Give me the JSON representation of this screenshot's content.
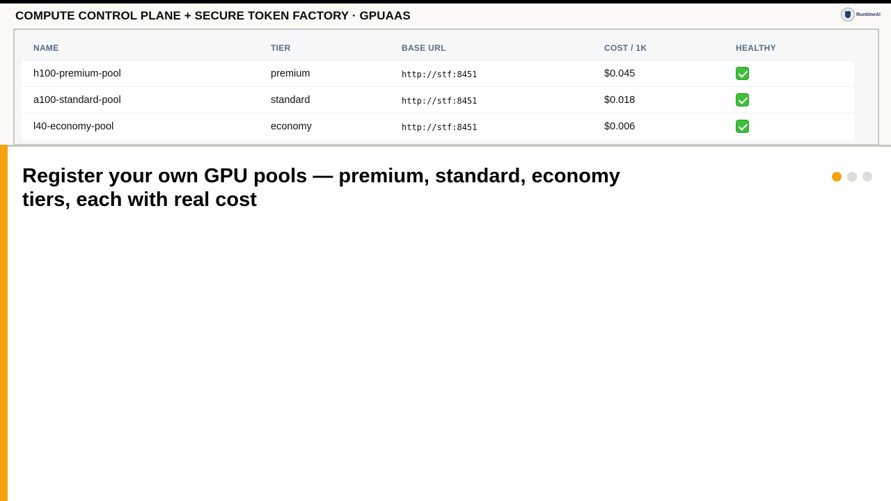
{
  "header": {
    "title": "COMPUTE CONTROL PLANE + SECURE TOKEN FACTORY · GPUAAS",
    "logo_text": "RuntimeAI",
    "logo_icon": "shield-logo-icon"
  },
  "table": {
    "columns": [
      "NAME",
      "TIER",
      "BASE URL",
      "COST / 1K",
      "HEALTHY"
    ],
    "rows": [
      {
        "name": "h100-premium-pool",
        "tier": "premium",
        "base_url": "http://stf:8451",
        "cost": "$0.045",
        "healthy_icon": "check-mark-icon"
      },
      {
        "name": "a100-standard-pool",
        "tier": "standard",
        "base_url": "http://stf:8451",
        "cost": "$0.018",
        "healthy_icon": "check-mark-icon"
      },
      {
        "name": "l40-economy-pool",
        "tier": "economy",
        "base_url": "http://stf:8451",
        "cost": "$0.006",
        "healthy_icon": "check-mark-icon"
      }
    ]
  },
  "caption": {
    "headline": "Register your own GPU pools — premium, standard, economy tiers, each with real cost"
  },
  "pagination": {
    "total": 3,
    "active_index": 0
  },
  "colors": {
    "accent": "#f5a20f",
    "healthy": "#3fbf3a",
    "header_text": "#5a6b85"
  }
}
